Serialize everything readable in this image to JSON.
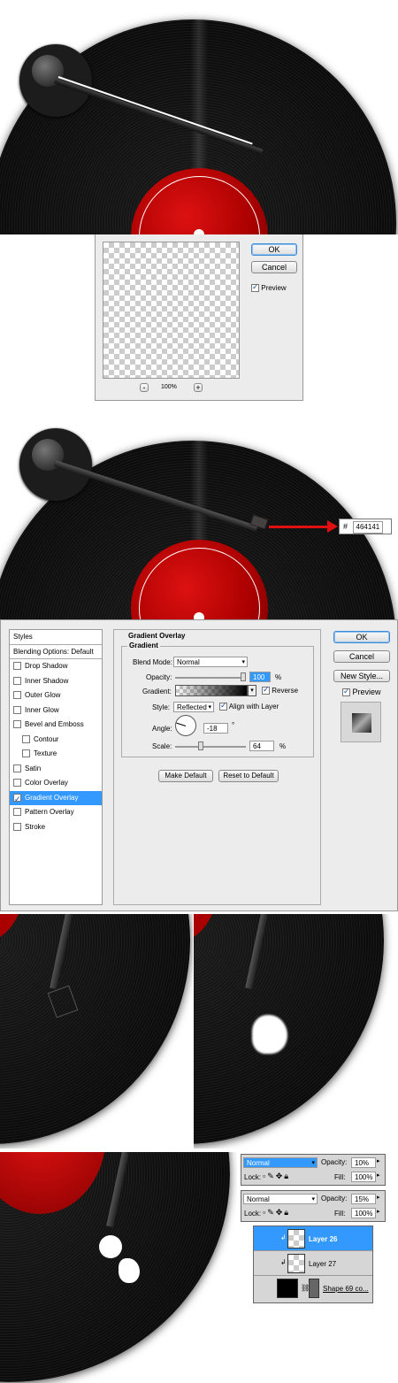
{
  "filter_dialog": {
    "ok_label": "OK",
    "cancel_label": "Cancel",
    "preview_label": "Preview",
    "zoom_out": "-",
    "zoom_in": "+",
    "zoom_level": "100%"
  },
  "color_callout": {
    "hash": "#",
    "hex": "464141"
  },
  "layer_style": {
    "left_title": "Styles",
    "blending": "Blending Options: Default",
    "styles": [
      {
        "label": "Drop Shadow",
        "checked": false,
        "indent": false
      },
      {
        "label": "Inner Shadow",
        "checked": false,
        "indent": false
      },
      {
        "label": "Outer Glow",
        "checked": false,
        "indent": false
      },
      {
        "label": "Inner Glow",
        "checked": false,
        "indent": false
      },
      {
        "label": "Bevel and Emboss",
        "checked": false,
        "indent": false
      },
      {
        "label": "Contour",
        "checked": false,
        "indent": true
      },
      {
        "label": "Texture",
        "checked": false,
        "indent": true
      },
      {
        "label": "Satin",
        "checked": false,
        "indent": false
      },
      {
        "label": "Color Overlay",
        "checked": false,
        "indent": false
      },
      {
        "label": "Gradient Overlay",
        "checked": true,
        "indent": false
      },
      {
        "label": "Pattern Overlay",
        "checked": false,
        "indent": false
      },
      {
        "label": "Stroke",
        "checked": false,
        "indent": false
      }
    ],
    "section_title": "Gradient Overlay",
    "group_title": "Gradient",
    "blend_mode_label": "Blend Mode:",
    "blend_mode_value": "Normal",
    "opacity_label": "Opacity:",
    "opacity_value": "100",
    "percent": "%",
    "gradient_label": "Gradient:",
    "reverse_label": "Reverse",
    "style_label": "Style:",
    "style_value": "Reflected",
    "align_label": "Align with Layer",
    "angle_label": "Angle:",
    "angle_value": "-18",
    "degree": "°",
    "scale_label": "Scale:",
    "scale_value": "64",
    "make_default": "Make Default",
    "reset_default": "Reset to Default",
    "ok": "OK",
    "cancel": "Cancel",
    "new_style": "New Style...",
    "preview": "Preview"
  },
  "layers_panel_1": {
    "mode": "Normal",
    "opacity_label": "Opacity:",
    "opacity_value": "10%",
    "lock_label": "Lock:",
    "fill_label": "Fill:",
    "fill_value": "100%"
  },
  "layers_panel_2": {
    "mode": "Normal",
    "opacity_label": "Opacity:",
    "opacity_value": "15%",
    "lock_label": "Lock:",
    "fill_label": "Fill:",
    "fill_value": "100%"
  },
  "layers": [
    {
      "name": "Layer 26",
      "selected": true
    },
    {
      "name": "Layer 27",
      "selected": false
    },
    {
      "name": "Shape 69 co...",
      "selected": false
    }
  ]
}
